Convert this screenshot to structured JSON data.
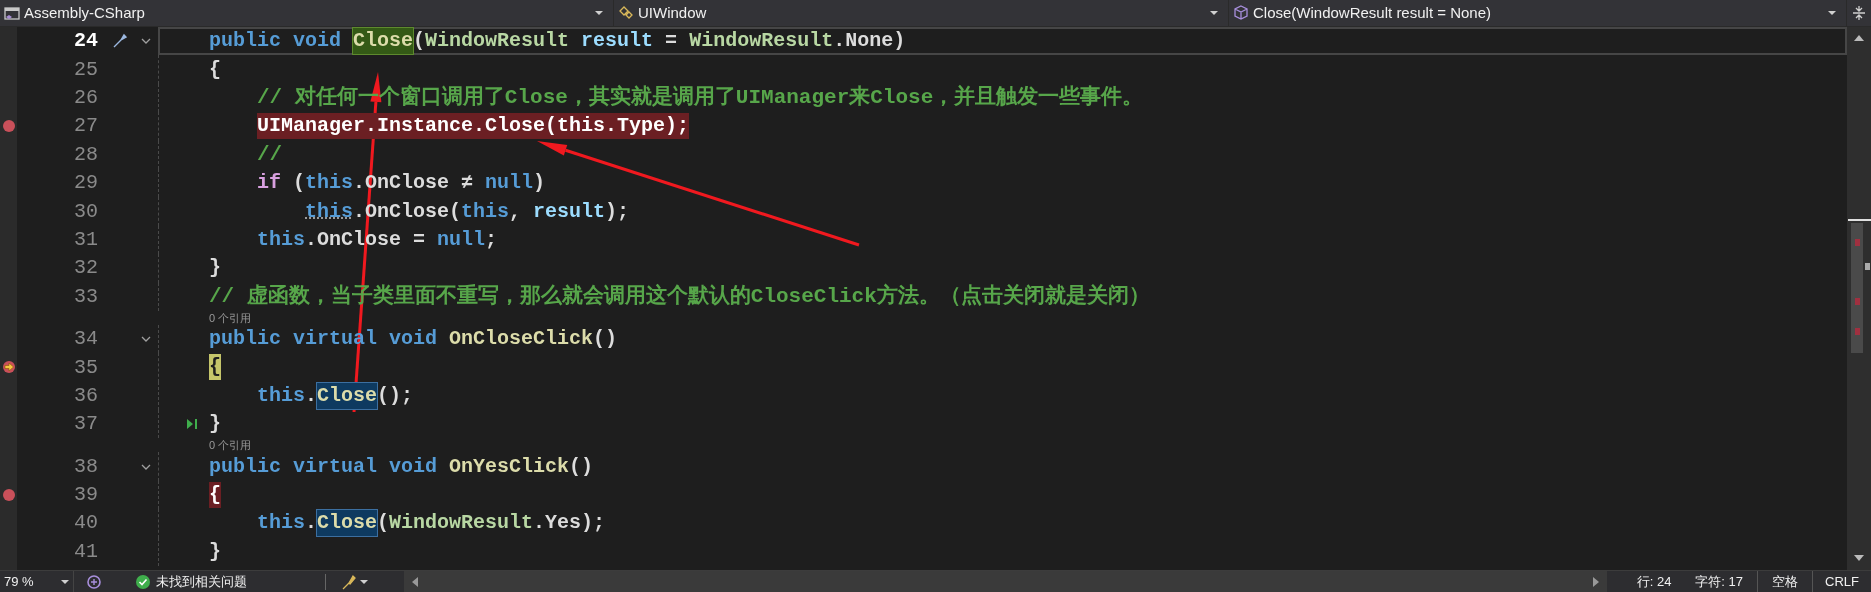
{
  "navigation_bar": {
    "dropdowns": [
      {
        "kind": "project",
        "text": "Assembly-CSharp"
      },
      {
        "kind": "class",
        "text": "UIWindow"
      },
      {
        "kind": "method",
        "text": "Close(WindowResult result = None)"
      }
    ]
  },
  "editor": {
    "lines": [
      {
        "number": "24",
        "current": true,
        "foldable": true,
        "breakpoint": false,
        "execution_point": false,
        "quick_action": true,
        "run_to_cursor": false,
        "tokens": [
          {
            "kind": "kw",
            "text": "public void "
          },
          {
            "kind": "definition",
            "text": "Close"
          },
          {
            "kind": "plain",
            "text": "("
          },
          {
            "kind": "enum",
            "text": "WindowResult "
          },
          {
            "kind": "param",
            "text": "result"
          },
          {
            "kind": "plain",
            "text": " = "
          },
          {
            "kind": "enum",
            "text": "WindowResult"
          },
          {
            "kind": "plain",
            "text": ".None)"
          }
        ]
      },
      {
        "number": "25",
        "current": false,
        "foldable": false,
        "breakpoint": false,
        "execution_point": false,
        "quick_action": false,
        "run_to_cursor": false,
        "tokens": [
          {
            "kind": "plain",
            "text": "{"
          }
        ]
      },
      {
        "number": "26",
        "current": false,
        "foldable": false,
        "breakpoint": false,
        "execution_point": false,
        "quick_action": false,
        "run_to_cursor": false,
        "tokens": [
          {
            "kind": "comment",
            "text": "    // 对任何一个窗口调用了Close，其实就是调用了UIManager来Close，并且触发一些事件。"
          }
        ]
      },
      {
        "number": "27",
        "current": false,
        "foldable": false,
        "breakpoint": true,
        "execution_point": false,
        "quick_action": false,
        "run_to_cursor": false,
        "tokens": [
          {
            "kind": "breakpoint",
            "text": "    UIManager.Instance.Close(this.Type);"
          }
        ]
      },
      {
        "number": "28",
        "current": false,
        "foldable": false,
        "breakpoint": false,
        "execution_point": false,
        "quick_action": false,
        "run_to_cursor": false,
        "tokens": [
          {
            "kind": "comment",
            "text": "    //"
          }
        ]
      },
      {
        "number": "29",
        "current": false,
        "foldable": false,
        "breakpoint": false,
        "execution_point": false,
        "quick_action": false,
        "run_to_cursor": false,
        "tokens": [
          {
            "kind": "ctrl",
            "text": "    if "
          },
          {
            "kind": "plain",
            "text": "("
          },
          {
            "kind": "kw",
            "text": "this"
          },
          {
            "kind": "plain",
            "text": ".OnClose ≠ "
          },
          {
            "kind": "kw",
            "text": "null"
          },
          {
            "kind": "plain",
            "text": ")"
          }
        ]
      },
      {
        "number": "30",
        "current": false,
        "foldable": false,
        "breakpoint": false,
        "execution_point": false,
        "quick_action": false,
        "run_to_cursor": false,
        "tokens": [
          {
            "kind": "hinted-kw",
            "text": "        this"
          },
          {
            "kind": "plain",
            "text": ".OnClose("
          },
          {
            "kind": "kw",
            "text": "this"
          },
          {
            "kind": "plain",
            "text": ", "
          },
          {
            "kind": "param",
            "text": "result"
          },
          {
            "kind": "plain",
            "text": ");"
          }
        ]
      },
      {
        "number": "31",
        "current": false,
        "foldable": false,
        "breakpoint": false,
        "execution_point": false,
        "quick_action": false,
        "run_to_cursor": false,
        "tokens": [
          {
            "kind": "kw",
            "text": "    this"
          },
          {
            "kind": "plain",
            "text": ".OnClose = "
          },
          {
            "kind": "kw",
            "text": "null"
          },
          {
            "kind": "plain",
            "text": ";"
          }
        ]
      },
      {
        "number": "32",
        "current": false,
        "foldable": false,
        "breakpoint": false,
        "execution_point": false,
        "quick_action": false,
        "run_to_cursor": false,
        "tokens": [
          {
            "kind": "plain",
            "text": "}"
          }
        ]
      },
      {
        "number": "33",
        "current": false,
        "foldable": false,
        "breakpoint": false,
        "execution_point": false,
        "quick_action": false,
        "run_to_cursor": false,
        "tokens": [
          {
            "kind": "comment",
            "text": "// 虚函数，当子类里面不重写，那么就会调用这个默认的CloseClick方法。（点击关闭就是关闭）"
          }
        ]
      },
      {
        "number": "34",
        "current": false,
        "foldable": true,
        "breakpoint": false,
        "execution_point": false,
        "quick_action": false,
        "run_to_cursor": false,
        "codelens": "0 个引用",
        "tokens": [
          {
            "kind": "kw",
            "text": "public virtual void "
          },
          {
            "kind": "method",
            "text": "OnCloseClick"
          },
          {
            "kind": "plain",
            "text": "()"
          }
        ]
      },
      {
        "number": "35",
        "current": false,
        "foldable": false,
        "breakpoint": false,
        "execution_point": true,
        "quick_action": false,
        "run_to_cursor": false,
        "tokens": [
          {
            "kind": "current-brace",
            "text": "{"
          }
        ]
      },
      {
        "number": "36",
        "current": false,
        "foldable": false,
        "breakpoint": false,
        "execution_point": false,
        "quick_action": false,
        "run_to_cursor": false,
        "tokens": [
          {
            "kind": "kw",
            "text": "    this"
          },
          {
            "kind": "plain",
            "text": "."
          },
          {
            "kind": "reference",
            "text": "Close"
          },
          {
            "kind": "plain",
            "text": "();"
          }
        ]
      },
      {
        "number": "37",
        "current": false,
        "foldable": false,
        "breakpoint": false,
        "execution_point": false,
        "quick_action": false,
        "run_to_cursor": true,
        "tokens": [
          {
            "kind": "plain",
            "text": "}"
          }
        ]
      },
      {
        "number": "38",
        "current": false,
        "foldable": true,
        "breakpoint": false,
        "execution_point": false,
        "quick_action": false,
        "run_to_cursor": false,
        "codelens": "0 个引用",
        "tokens": [
          {
            "kind": "kw",
            "text": "public virtual void "
          },
          {
            "kind": "method",
            "text": "OnYesClick"
          },
          {
            "kind": "plain",
            "text": "()"
          }
        ]
      },
      {
        "number": "39",
        "current": false,
        "foldable": false,
        "breakpoint": true,
        "execution_point": false,
        "quick_action": false,
        "run_to_cursor": false,
        "tokens": [
          {
            "kind": "breakpoint",
            "text": "{"
          }
        ]
      },
      {
        "number": "40",
        "current": false,
        "foldable": false,
        "breakpoint": false,
        "execution_point": false,
        "quick_action": false,
        "run_to_cursor": false,
        "tokens": [
          {
            "kind": "kw",
            "text": "    this"
          },
          {
            "kind": "plain",
            "text": "."
          },
          {
            "kind": "reference",
            "text": "Close"
          },
          {
            "kind": "plain",
            "text": "("
          },
          {
            "kind": "enum",
            "text": "WindowResult"
          },
          {
            "kind": "plain",
            "text": ".Yes);"
          }
        ]
      },
      {
        "number": "41",
        "current": false,
        "foldable": false,
        "breakpoint": false,
        "execution_point": false,
        "quick_action": false,
        "run_to_cursor": false,
        "tokens": [
          {
            "kind": "plain",
            "text": "}"
          }
        ]
      }
    ]
  },
  "annotations": [
    {
      "kind": "arrow"
    },
    {
      "kind": "arrow"
    }
  ],
  "status_bar": {
    "zoom": "79 %",
    "issues": "未找到相关问题",
    "line": "行: 24",
    "column": "字符: 17",
    "indent": "空格",
    "line_ending": "CRLF"
  }
}
